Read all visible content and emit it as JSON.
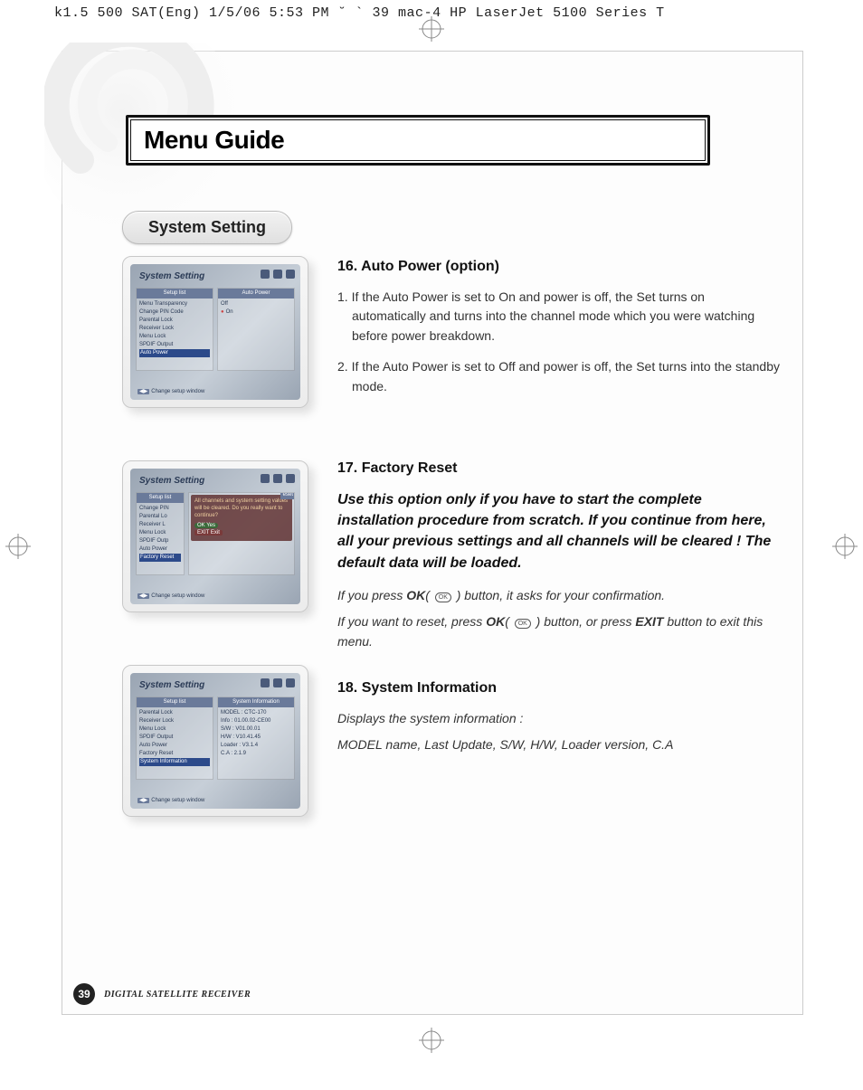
{
  "print_header": "k1.5 500 SAT(Eng)  1/5/06 5:53 PM  ˘   `  39   mac-4 HP LaserJet 5100 Series  T",
  "title": "Menu Guide",
  "pill_label": "System Setting",
  "footer": {
    "page": "39",
    "label": "DIGITAL SATELLITE RECEIVER"
  },
  "section16": {
    "heading": "16. Auto Power (option)",
    "p1": "1. If the Auto Power is set to On and power is off, the Set turns on automatically and turns into the channel mode which you were watching before power breakdown.",
    "p2": "2. If the Auto Power is set to Off and power is off, the Set turns into the standby mode."
  },
  "section17": {
    "heading": "17. Factory Reset",
    "warn": "Use this option only if you have to start the complete installation procedure from scratch. If you continue from here, all your previous settings and all channels will be cleared ! The default data will be loaded.",
    "line1_a": "If you press ",
    "line1_ok": "OK",
    "line1_b": "( ",
    "line1_c": " ) button, it asks for your confirmation.",
    "line2_a": "If you want to reset, press ",
    "line2_ok": "OK",
    "line2_b": "( ",
    "line2_c": " ) button, or press ",
    "line2_exit": "EXIT",
    "line2_d": " button to exit this menu."
  },
  "section18": {
    "heading": "18. System Information",
    "body1": "Displays the system information :",
    "body2": "MODEL name, Last Update, S/W, H/W, Loader version, C.A"
  },
  "shot": {
    "title": "System Setting",
    "hint_tag": "◀▶",
    "hint_text": "Change setup window"
  },
  "shot1": {
    "left_header": "Setup list",
    "right_header": "Auto Power",
    "items": [
      "Menu Transparency",
      "Change PIN Code",
      "Parental Lock",
      "Receiver Lock",
      "Menu Lock",
      "SPDIF Output"
    ],
    "highlight": "Auto Power",
    "r_off": "Off",
    "r_on": "On"
  },
  "shot2": {
    "left_header": "Setup list",
    "items": [
      "Change PIN",
      "Parental Lo",
      "Receiver L",
      "Menu Lock",
      "SPDIF Outp",
      "Auto Power"
    ],
    "highlight": "Factory Reset",
    "dialog": "All channels and system setting values will be cleared. Do you really want to continue?",
    "btn_yes": "OK    Yes",
    "btn_exit": "EXIT  Exit",
    "tab": "eset"
  },
  "shot3": {
    "left_header": "Setup list",
    "right_header": "System Information",
    "items": [
      "Parental Lock",
      "Receiver Lock",
      "Menu Lock",
      "SPDIF Output",
      "Auto Power",
      "Factory Reset"
    ],
    "highlight": "System Information",
    "info": [
      "MODEL : CTC-170",
      "Info : 01.00.02-CE00",
      "S/W : V01.00.01",
      "H/W : V10.41.45",
      "Loader : V3.1.4",
      "C.A : 2.1.9"
    ]
  }
}
